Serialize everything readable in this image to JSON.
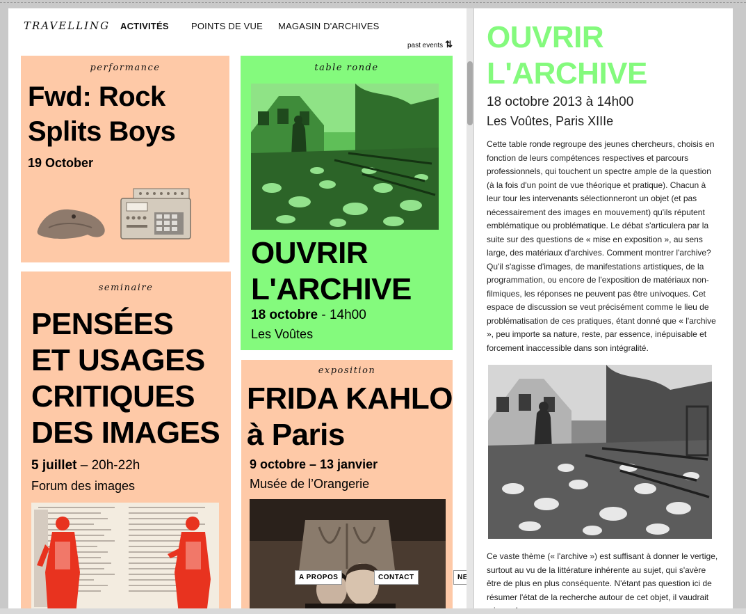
{
  "nav": {
    "brand": "TRAVELLING",
    "items": [
      {
        "label": "ACTIVITÉS",
        "active": true
      },
      {
        "label": "POINTS DE VUE",
        "active": false
      },
      {
        "label": "MAGASIN D'ARCHIVES",
        "active": false
      }
    ],
    "past_events": "past events",
    "past_events_icon": "sort-arrows-icon"
  },
  "cards": {
    "performance": {
      "category": "performance",
      "title_lines": [
        "Fwd: Rock",
        "Splits Boys"
      ],
      "date": "19 October"
    },
    "table_ronde": {
      "category": "table ronde",
      "title_lines": [
        "OUVRIR",
        "L'ARCHIVE"
      ],
      "date_bold": "18 octobre",
      "date_rest": " - 14h00",
      "place": "Les Voûtes"
    },
    "seminaire": {
      "category": "seminaire",
      "title_lines": [
        "PENSÉES",
        "ET USAGES",
        "CRITIQUES",
        "DES IMAGES"
      ],
      "date_bold": "5 juillet",
      "date_rest": " – 20h-22h",
      "place": "Forum des images"
    },
    "exposition": {
      "category": "exposition",
      "title_lines": [
        "FRIDA KAHLO",
        "à Paris"
      ],
      "date_bold": "9 octobre – 13 janvier",
      "place": "Musée de l’Orangerie"
    }
  },
  "footer": {
    "a_propos": "A PROPOS",
    "contact": "CONTACT",
    "newsletter": "NEWSLETTER"
  },
  "article": {
    "title_lines": [
      "OUVRIR",
      "L'ARCHIVE"
    ],
    "date": "18 octobre 2013 à 14h00",
    "place": "Les Voûtes, Paris XIIIe",
    "body": "Cette table ronde regroupe des jeunes chercheurs, choisis en fonction de leurs compétences respectives et parcours professionnels, qui touchent un spectre ample de la question (à la fois d'un point de vue théorique et pratique). Chacun à leur tour les intervenants sélectionneront un objet (et pas nécessairement des images en mouvement) qu'ils réputent emblématique ou problématique. Le débat s'articulera par la suite sur des questions de «  mise en exposition  », au sens large, des matériaux d'archives. Comment montrer l'archive? Qu'il s'agisse d'images, de manifestations artistiques, de la programmation, ou encore de l'exposition de matériaux non-filmiques, les réponses ne peuvent pas être univoques. Cet espace de discussion se veut précisément comme le lieu de problématisation de ces pratiques, étant donné que «  l'archive », peu importe sa nature, reste, par essence, inépuisable et forcement inaccessible dans son intégralité.",
    "body2": "Ce vaste thème («  l'archive  ») est suffisant à donner le vertige, surtout au vu de la littérature inhérente au sujet, qui s'avère être de plus en plus conséquente. N'étant pas question ici de résumer l'état de la recherche autour de cet objet, il vaudrait mieux alors"
  },
  "colors": {
    "accent_green": "#84fa7d",
    "peach": "#fec9a7",
    "red_overlay": "#e8331f"
  }
}
